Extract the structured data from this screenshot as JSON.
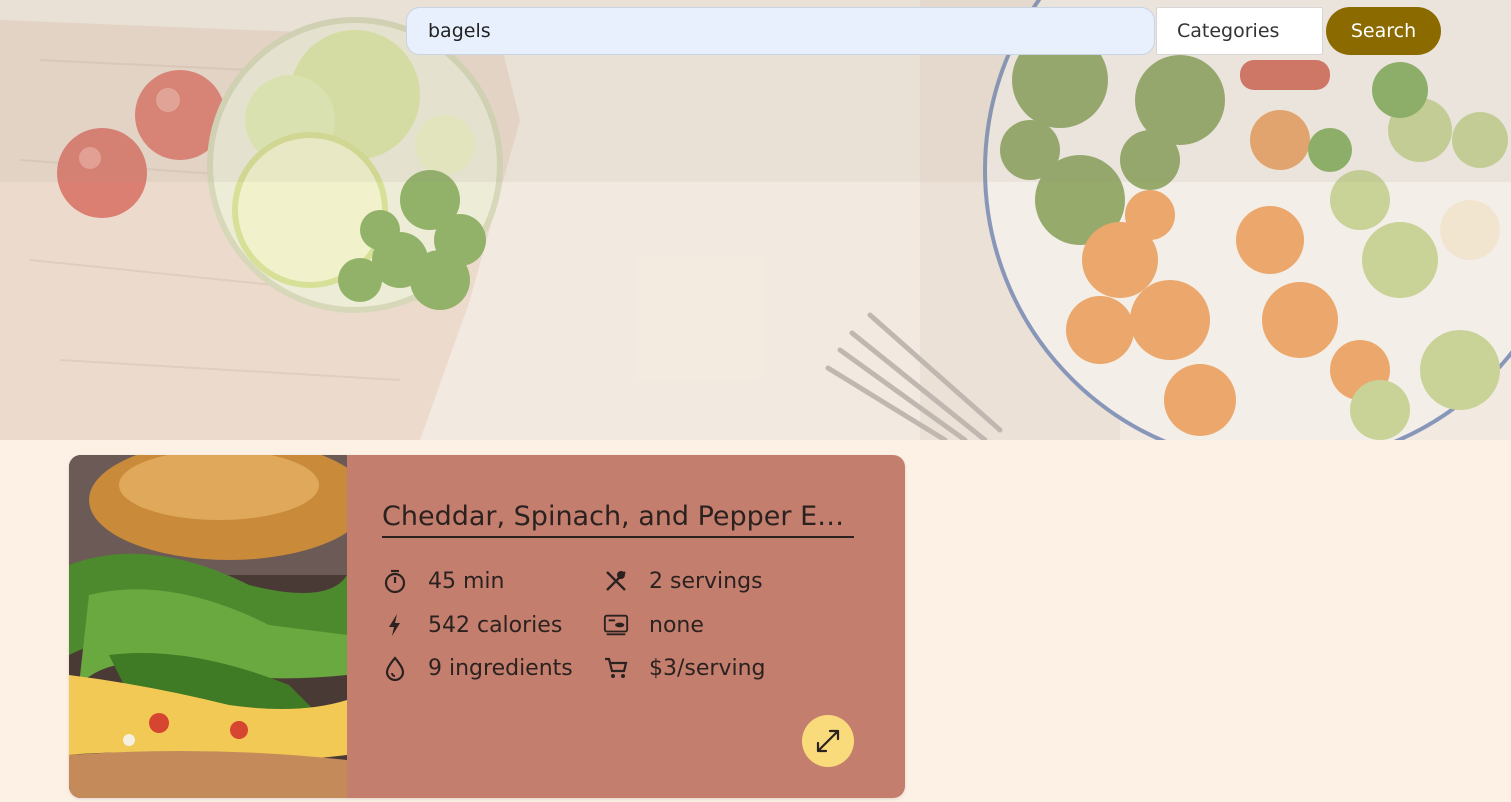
{
  "search": {
    "query": "bagels",
    "categories_label": "Categories",
    "button_label": "Search"
  },
  "recipe": {
    "title": "Cheddar, Spinach, and Pepper Egg Bagel Sandwich",
    "stats": {
      "time": "45 min",
      "servings": "2 servings",
      "calories": "542 calories",
      "diet": "none",
      "ingredients": "9 ingredients",
      "price": "$3/serving"
    },
    "icons": {
      "time": "timer-icon",
      "servings": "utensils-icon",
      "calories": "lightning-icon",
      "diet": "diet-icon",
      "ingredients": "drop-icon",
      "price": "cart-icon",
      "expand": "expand-icon"
    }
  },
  "colors": {
    "background": "#fdf1e6",
    "card": "#c47e6e",
    "search_button": "#8b6a00",
    "expand_button": "#f9db7c",
    "search_input": "#e8f0fe"
  }
}
